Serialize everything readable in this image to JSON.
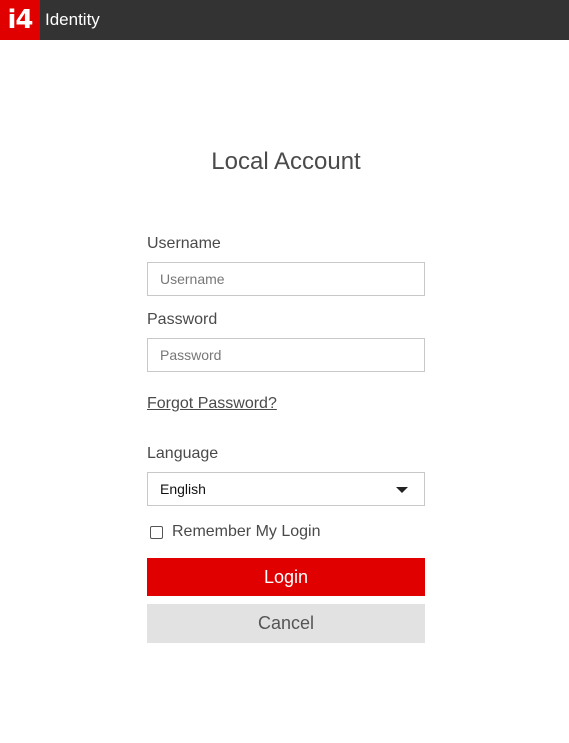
{
  "header": {
    "logo_text": "i4",
    "app_name": "Identity",
    "brand_color": "#e00000",
    "bar_color": "#333333"
  },
  "form": {
    "title": "Local Account",
    "username_label": "Username",
    "username_placeholder": "Username",
    "username_value": "",
    "password_label": "Password",
    "password_placeholder": "Password",
    "password_value": "",
    "forgot_link": "Forgot Password?",
    "language_label": "Language",
    "language_selected": "English",
    "remember_label": "Remember My Login",
    "remember_checked": false,
    "login_label": "Login",
    "cancel_label": "Cancel"
  }
}
